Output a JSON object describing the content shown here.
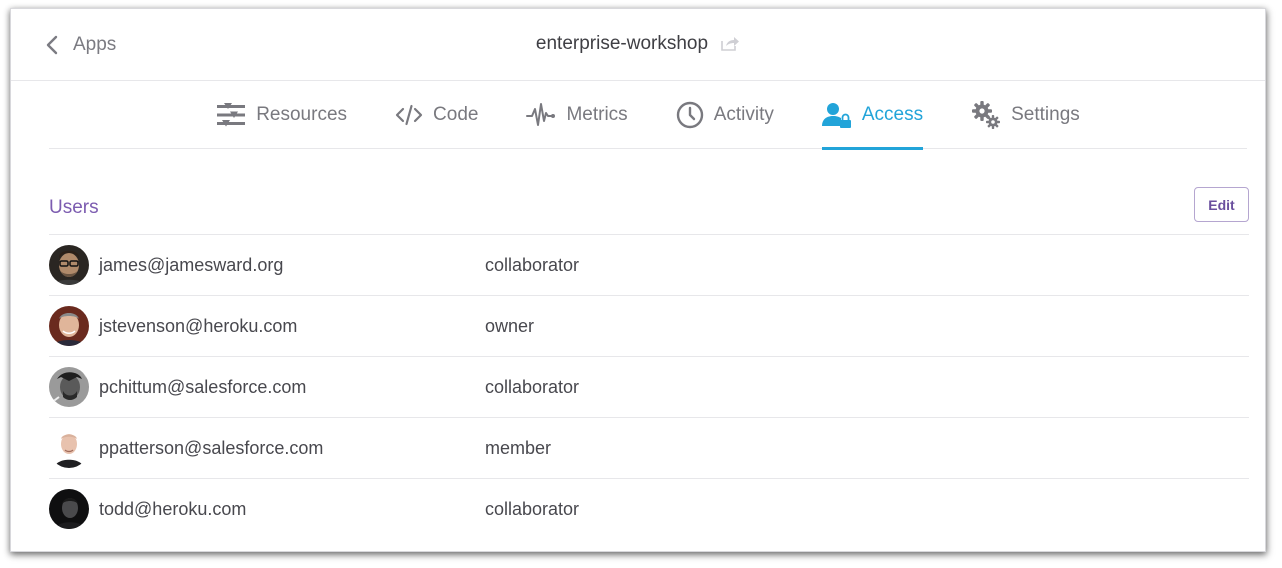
{
  "header": {
    "back_label": "Apps",
    "app_name": "enterprise-workshop"
  },
  "tabs": [
    {
      "label": "Resources",
      "icon": "resources-icon",
      "active": false
    },
    {
      "label": "Code",
      "icon": "code-icon",
      "active": false
    },
    {
      "label": "Metrics",
      "icon": "metrics-icon",
      "active": false
    },
    {
      "label": "Activity",
      "icon": "activity-clock-icon",
      "active": false
    },
    {
      "label": "Access",
      "icon": "user-lock-icon",
      "active": true
    },
    {
      "label": "Settings",
      "icon": "gears-icon",
      "active": false
    }
  ],
  "users_section": {
    "title": "Users",
    "edit_label": "Edit",
    "rows": [
      {
        "email": "james@jamesward.org",
        "role": "collaborator"
      },
      {
        "email": "jstevenson@heroku.com",
        "role": "owner"
      },
      {
        "email": "pchittum@salesforce.com",
        "role": "collaborator"
      },
      {
        "email": "ppatterson@salesforce.com",
        "role": "member"
      },
      {
        "email": "todd@heroku.com",
        "role": "collaborator"
      }
    ]
  },
  "colors": {
    "accent": "#22a4d9",
    "purple": "#7c5cb0",
    "muted": "#79797f"
  }
}
